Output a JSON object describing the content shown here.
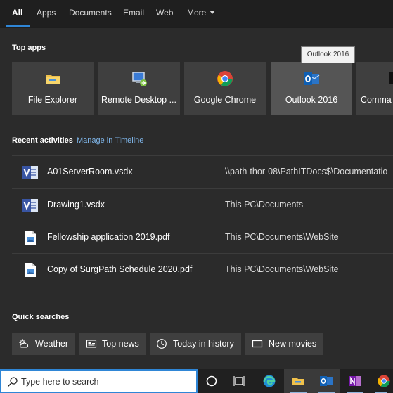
{
  "tabs": [
    {
      "label": "All",
      "active": true
    },
    {
      "label": "Apps"
    },
    {
      "label": "Documents"
    },
    {
      "label": "Email"
    },
    {
      "label": "Web"
    },
    {
      "label": "More"
    }
  ],
  "top_apps": {
    "title": "Top apps",
    "tooltip": "Outlook 2016",
    "items": [
      {
        "label": "File Explorer",
        "icon": "folder-icon"
      },
      {
        "label": "Remote Desktop ...",
        "icon": "remote-desktop-icon"
      },
      {
        "label": "Google Chrome",
        "icon": "chrome-icon"
      },
      {
        "label": "Outlook 2016",
        "icon": "outlook-icon",
        "hovered": true
      },
      {
        "label": "Comma",
        "icon": "command-prompt-icon"
      }
    ]
  },
  "recent": {
    "title": "Recent activities",
    "timeline_link": "Manage in Timeline",
    "items": [
      {
        "name": "A01ServerRoom.vsdx",
        "path": "\\\\path-thor-08\\PathITDocs$\\Documentatio",
        "icon": "visio-icon"
      },
      {
        "name": "Drawing1.vsdx",
        "path": "This PC\\Documents",
        "icon": "visio-icon"
      },
      {
        "name": "Fellowship application 2019.pdf",
        "path": "This PC\\Documents\\WebSite",
        "icon": "pdf-file-icon"
      },
      {
        "name": "Copy of SurgPath Schedule 2020.pdf",
        "path": "This PC\\Documents\\WebSite",
        "icon": "pdf-file-icon"
      }
    ]
  },
  "quick_searches": {
    "title": "Quick searches",
    "items": [
      {
        "label": "Weather",
        "icon": "weather-icon"
      },
      {
        "label": "Top news",
        "icon": "news-icon"
      },
      {
        "label": "Today in history",
        "icon": "clock-icon"
      },
      {
        "label": "New movies",
        "icon": "movie-icon"
      }
    ]
  },
  "taskbar": {
    "search_placeholder": "Type here to search",
    "buttons": [
      "cortana-icon",
      "task-view-icon",
      "edge-icon",
      "file-explorer-icon",
      "outlook-icon",
      "onenote-icon",
      "chrome-icon"
    ]
  },
  "colors": {
    "accent": "#2f86d6",
    "panel": "#2b2b2b",
    "tile": "#3f3f3f",
    "tile_hover": "#555555",
    "link": "#7fb6ea"
  }
}
